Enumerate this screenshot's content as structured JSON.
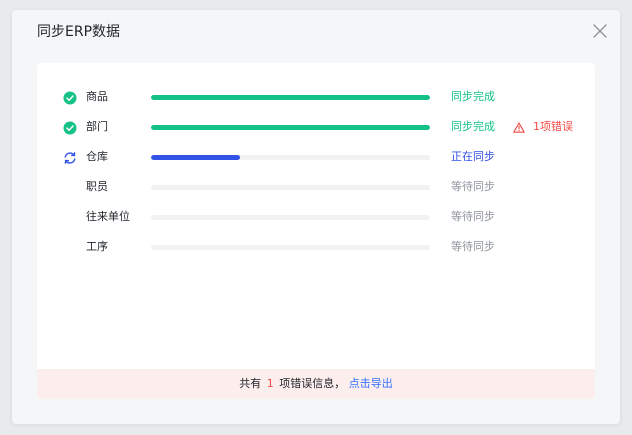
{
  "dialog": {
    "title": "同步ERP数据",
    "close_icon": "close-icon"
  },
  "colors": {
    "success": "#15c285",
    "syncing": "#3352e6",
    "waiting": "#8f959e",
    "error": "#f54a45",
    "link": "#3370ff"
  },
  "rows": [
    {
      "label": "商品",
      "status": "同步完成",
      "state": "done",
      "progress": 1.0,
      "icon": "check-circle-icon",
      "error": ""
    },
    {
      "label": "部门",
      "status": "同步完成",
      "state": "done",
      "progress": 1.0,
      "icon": "check-circle-icon",
      "error": "1项错误"
    },
    {
      "label": "仓库",
      "status": "正在同步",
      "state": "syncing",
      "progress": 0.32,
      "icon": "sync-icon",
      "error": ""
    },
    {
      "label": "职员",
      "status": "等待同步",
      "state": "waiting",
      "progress": 0,
      "icon": "",
      "error": ""
    },
    {
      "label": "往来单位",
      "status": "等待同步",
      "state": "waiting",
      "progress": 0,
      "icon": "",
      "error": ""
    },
    {
      "label": "工序",
      "status": "等待同步",
      "state": "waiting",
      "progress": 0,
      "icon": "",
      "error": ""
    }
  ],
  "footer": {
    "prefix": "共有",
    "count": "1",
    "suffix": "项错误信息，",
    "link": "点击导出"
  }
}
